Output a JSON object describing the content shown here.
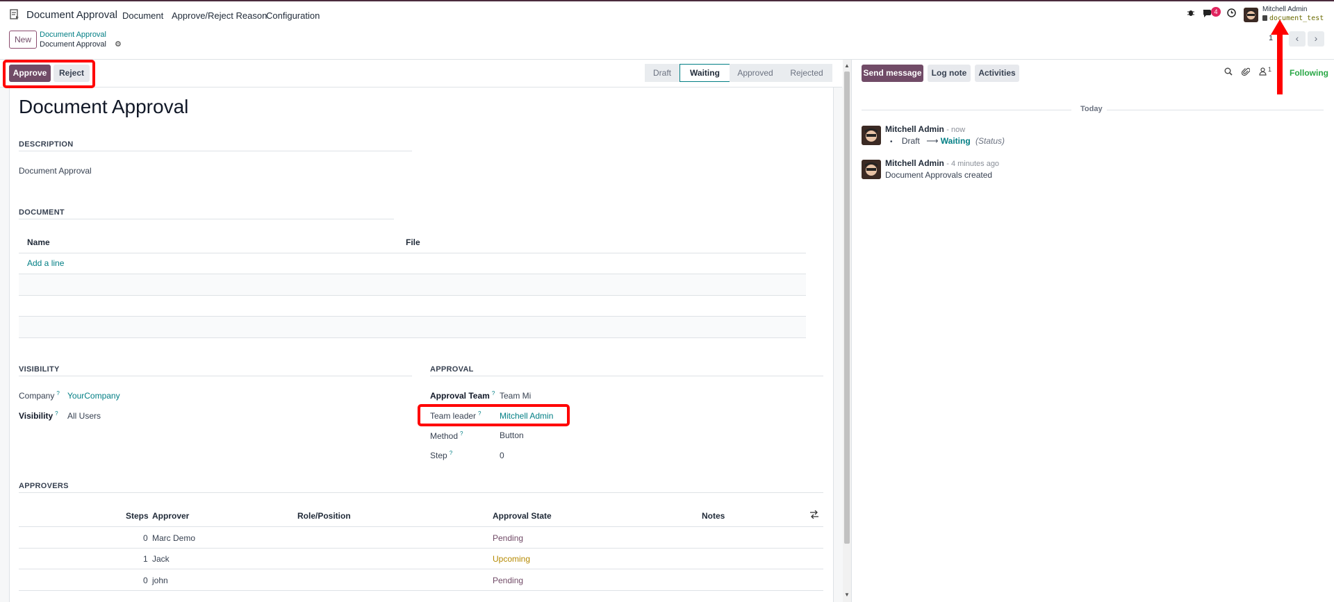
{
  "navbar": {
    "app_name": "Document Approval",
    "menus": [
      "Document",
      "Approve/Reject Reason",
      "Configuration"
    ],
    "messages_badge": "4",
    "user_name": "Mitchell Admin",
    "database": "document_test"
  },
  "control_panel": {
    "new_label": "New",
    "breadcrumb_parent": "Document Approval",
    "breadcrumb_current": "Document Approval",
    "pager_value": "1"
  },
  "statusbar": {
    "approve_label": "Approve",
    "reject_label": "Reject",
    "stages": [
      "Draft",
      "Waiting",
      "Approved",
      "Rejected"
    ],
    "active_stage": "Waiting"
  },
  "form": {
    "title": "Document Approval",
    "description_header": "DESCRIPTION",
    "description_value": "Document Approval",
    "document_header": "DOCUMENT",
    "document_columns": [
      "Name",
      "File"
    ],
    "add_line_label": "Add a line",
    "visibility_header": "VISIBILITY",
    "company_label": "Company",
    "company_value": "YourCompany",
    "visibility_label": "Visibility",
    "visibility_value": "All Users",
    "approval_header": "APPROVAL",
    "approval_team_label": "Approval Team",
    "approval_team_value": "Team Mi",
    "team_leader_label": "Team leader",
    "team_leader_value": "Mitchell Admin",
    "method_label": "Method",
    "method_value": "Button",
    "step_label": "Step",
    "step_value": "0",
    "tooltip_mark": "?",
    "approvers_header": "APPROVERS",
    "approver_columns": [
      "Steps",
      "Approver",
      "Role/Position",
      "Approval State",
      "Notes"
    ],
    "approvers": [
      {
        "steps": "0",
        "approver": "Marc Demo",
        "state": "Pending"
      },
      {
        "steps": "1",
        "approver": "Jack",
        "state": "Upcoming"
      },
      {
        "steps": "0",
        "approver": "john",
        "state": "Pending"
      }
    ]
  },
  "chatter": {
    "send_message_label": "Send message",
    "log_note_label": "Log note",
    "activities_label": "Activities",
    "followers_count": "1",
    "following_label": "Following",
    "day_separator": "Today",
    "messages": [
      {
        "author": "Mitchell Admin",
        "date": "- now",
        "from": "Draft",
        "to": "Waiting",
        "field": "(Status)"
      },
      {
        "author": "Mitchell Admin",
        "date": "- 4 minutes ago",
        "body": "Document Approvals created"
      }
    ]
  },
  "colors": {
    "primary": "#714b67",
    "link": "#017e84",
    "highlight": "#ff0000",
    "following": "#28a745",
    "upcoming": "#b58900"
  }
}
